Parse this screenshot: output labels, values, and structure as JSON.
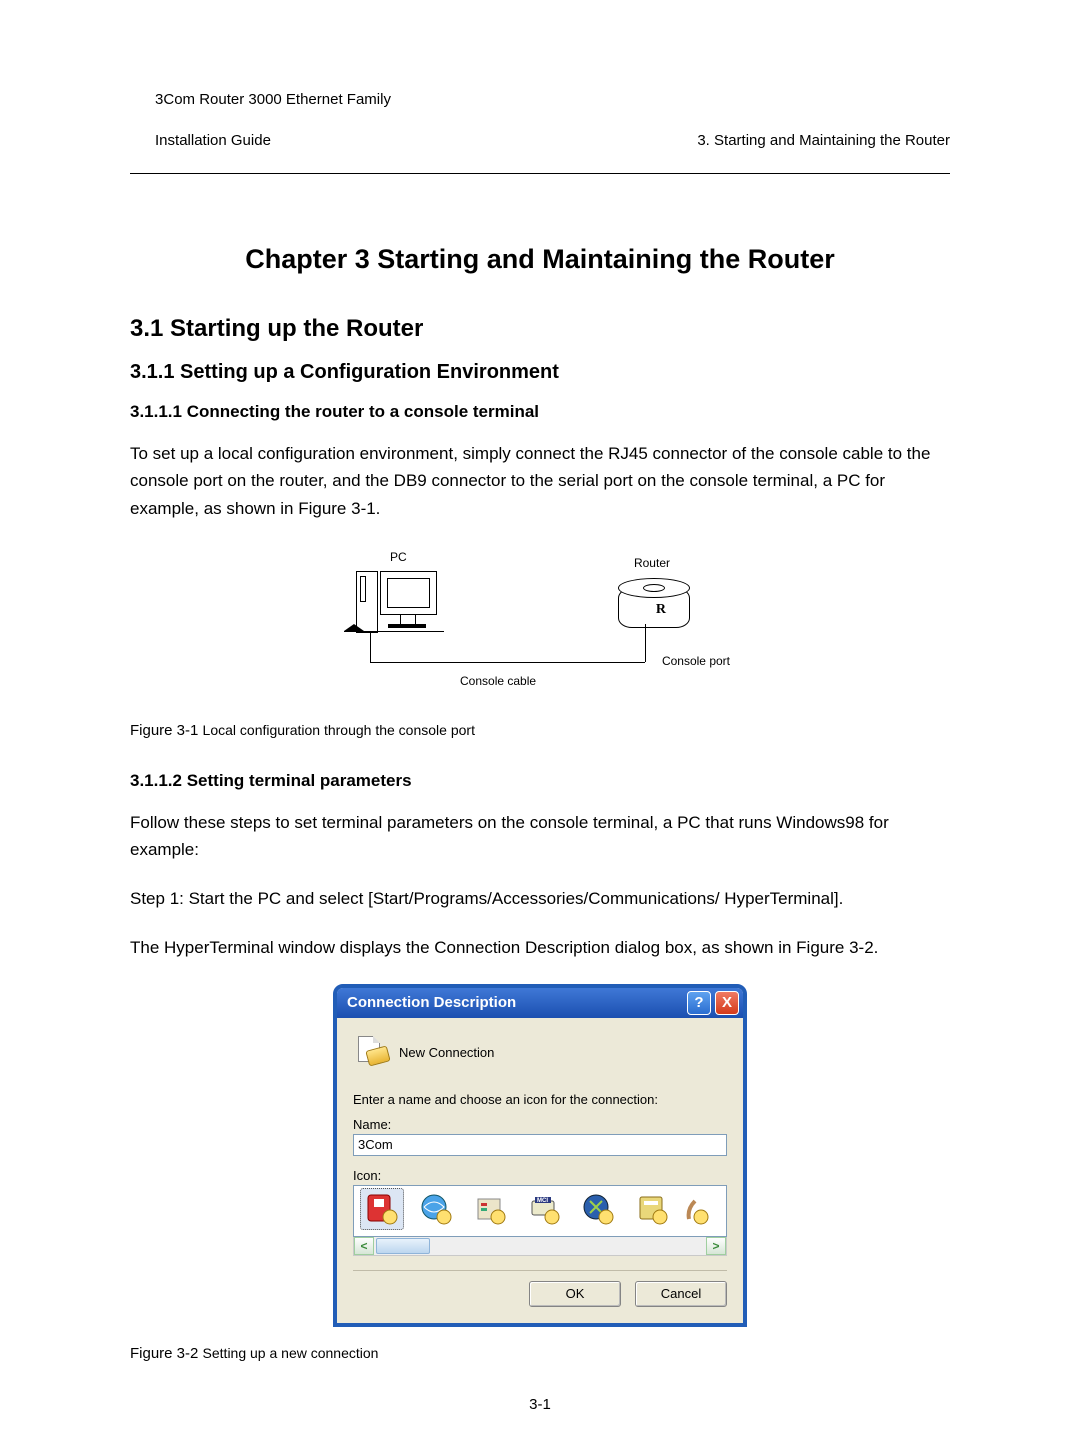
{
  "header": {
    "left_line1": "3Com Router 3000 Ethernet Family",
    "left_line2": "Installation Guide",
    "right_line2": "3. Starting and Maintaining the Router"
  },
  "chapter_title": "Chapter 3  Starting and Maintaining the Router",
  "section_3_1": "3.1  Starting up the Router",
  "section_3_1_1": "3.1.1  Setting up a Configuration Environment",
  "section_3_1_1_1": "3.1.1.1 Connecting the router to a console terminal",
  "para1": "To set up a local configuration environment, simply connect the RJ45 connector of the console cable to the console port on the router, and the DB9 connector to the serial port on the console terminal, a PC for example, as shown in Figure 3-1.",
  "fig1": {
    "pc_label": "PC",
    "router_label": "Router",
    "router_r": "R",
    "cable_label": "Console cable",
    "port_label": "Console port",
    "caption_prefix": "Figure 3-1 ",
    "caption_text": "Local configuration through the console port"
  },
  "section_3_1_1_2": "3.1.1.2 Setting terminal parameters",
  "para2": "Follow these steps to set terminal parameters on the console terminal, a PC that runs Windows98 for example:",
  "para3": "Step 1: Start the PC and select [Start/Programs/Accessories/Communications/ HyperTerminal].",
  "para4": "The HyperTerminal window displays the Connection Description dialog box, as shown in Figure 3-2.",
  "dialog": {
    "title": "Connection Description",
    "help_glyph": "?",
    "close_glyph": "X",
    "new_connection": "New Connection",
    "instruction": "Enter a name and choose an icon for the connection:",
    "name_label": "Name:",
    "name_value": "3Com",
    "icon_label": "Icon:",
    "left_arrow": "<",
    "right_arrow": ">",
    "ok": "OK",
    "cancel": "Cancel"
  },
  "fig2": {
    "caption_prefix": "Figure 3-2 ",
    "caption_text": "Setting up a new connection"
  },
  "page_number": "3-1"
}
